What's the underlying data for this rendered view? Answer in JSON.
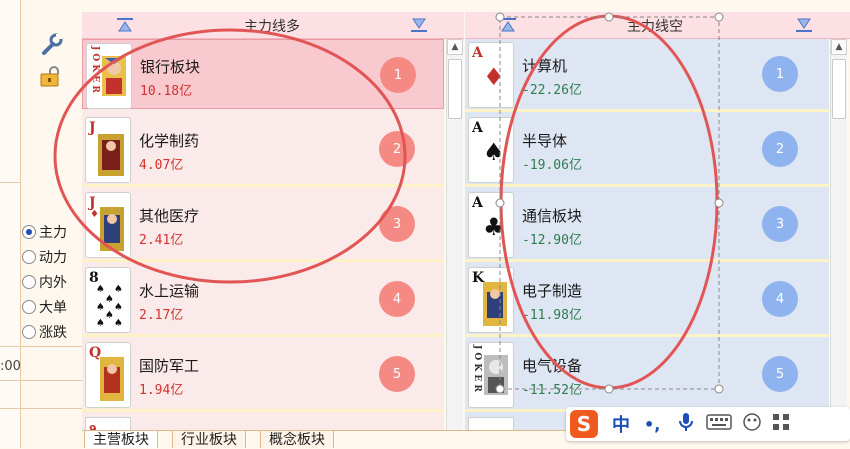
{
  "left_panel": {
    "tools": [
      "wrench-icon",
      "lock-folder-icon"
    ],
    "time_fragment": ":00",
    "radio_options": [
      {
        "label": "主力",
        "selected": true
      },
      {
        "label": "动力",
        "selected": false
      },
      {
        "label": "内外",
        "selected": false
      },
      {
        "label": "大单",
        "selected": false
      },
      {
        "label": "涨跌",
        "selected": false
      }
    ]
  },
  "long_panel": {
    "title": "主力线多",
    "rows": [
      {
        "card": "JOKER",
        "name": "银行板块",
        "value": "10.18亿",
        "rank": "1"
      },
      {
        "card": "J♥",
        "name": "化学制药",
        "value": "4.07亿",
        "rank": "2"
      },
      {
        "card": "J♦",
        "name": "其他医疗",
        "value": "2.41亿",
        "rank": "3"
      },
      {
        "card": "8♠",
        "name": "水上运输",
        "value": "2.17亿",
        "rank": "4"
      },
      {
        "card": "Q♦",
        "name": "国防军工",
        "value": "1.94亿",
        "rank": "5"
      }
    ]
  },
  "short_panel": {
    "title": "主力线空",
    "rows": [
      {
        "card": "A♦",
        "name": "计算机",
        "value": "-22.26亿",
        "rank": "1"
      },
      {
        "card": "A♠",
        "name": "半导体",
        "value": "-19.06亿",
        "rank": "2"
      },
      {
        "card": "A♣",
        "name": "通信板块",
        "value": "-12.90亿",
        "rank": "3"
      },
      {
        "card": "K♠",
        "name": "电子制造",
        "value": "-11.98亿",
        "rank": "4"
      },
      {
        "card": "JOKER",
        "name": "电气设备",
        "value": "-11.52亿",
        "rank": "5"
      }
    ]
  },
  "tabs": [
    "主营板块",
    "行业板块",
    "概念板块"
  ],
  "ime_toolbar": {
    "lang": "中",
    "punct": "•,"
  },
  "colors": {
    "long_value": "#d2332f",
    "short_value": "#2e7d4f",
    "long_badge": "#f58a85",
    "short_badge": "#8fb3ee",
    "annotation": "#e25555"
  }
}
